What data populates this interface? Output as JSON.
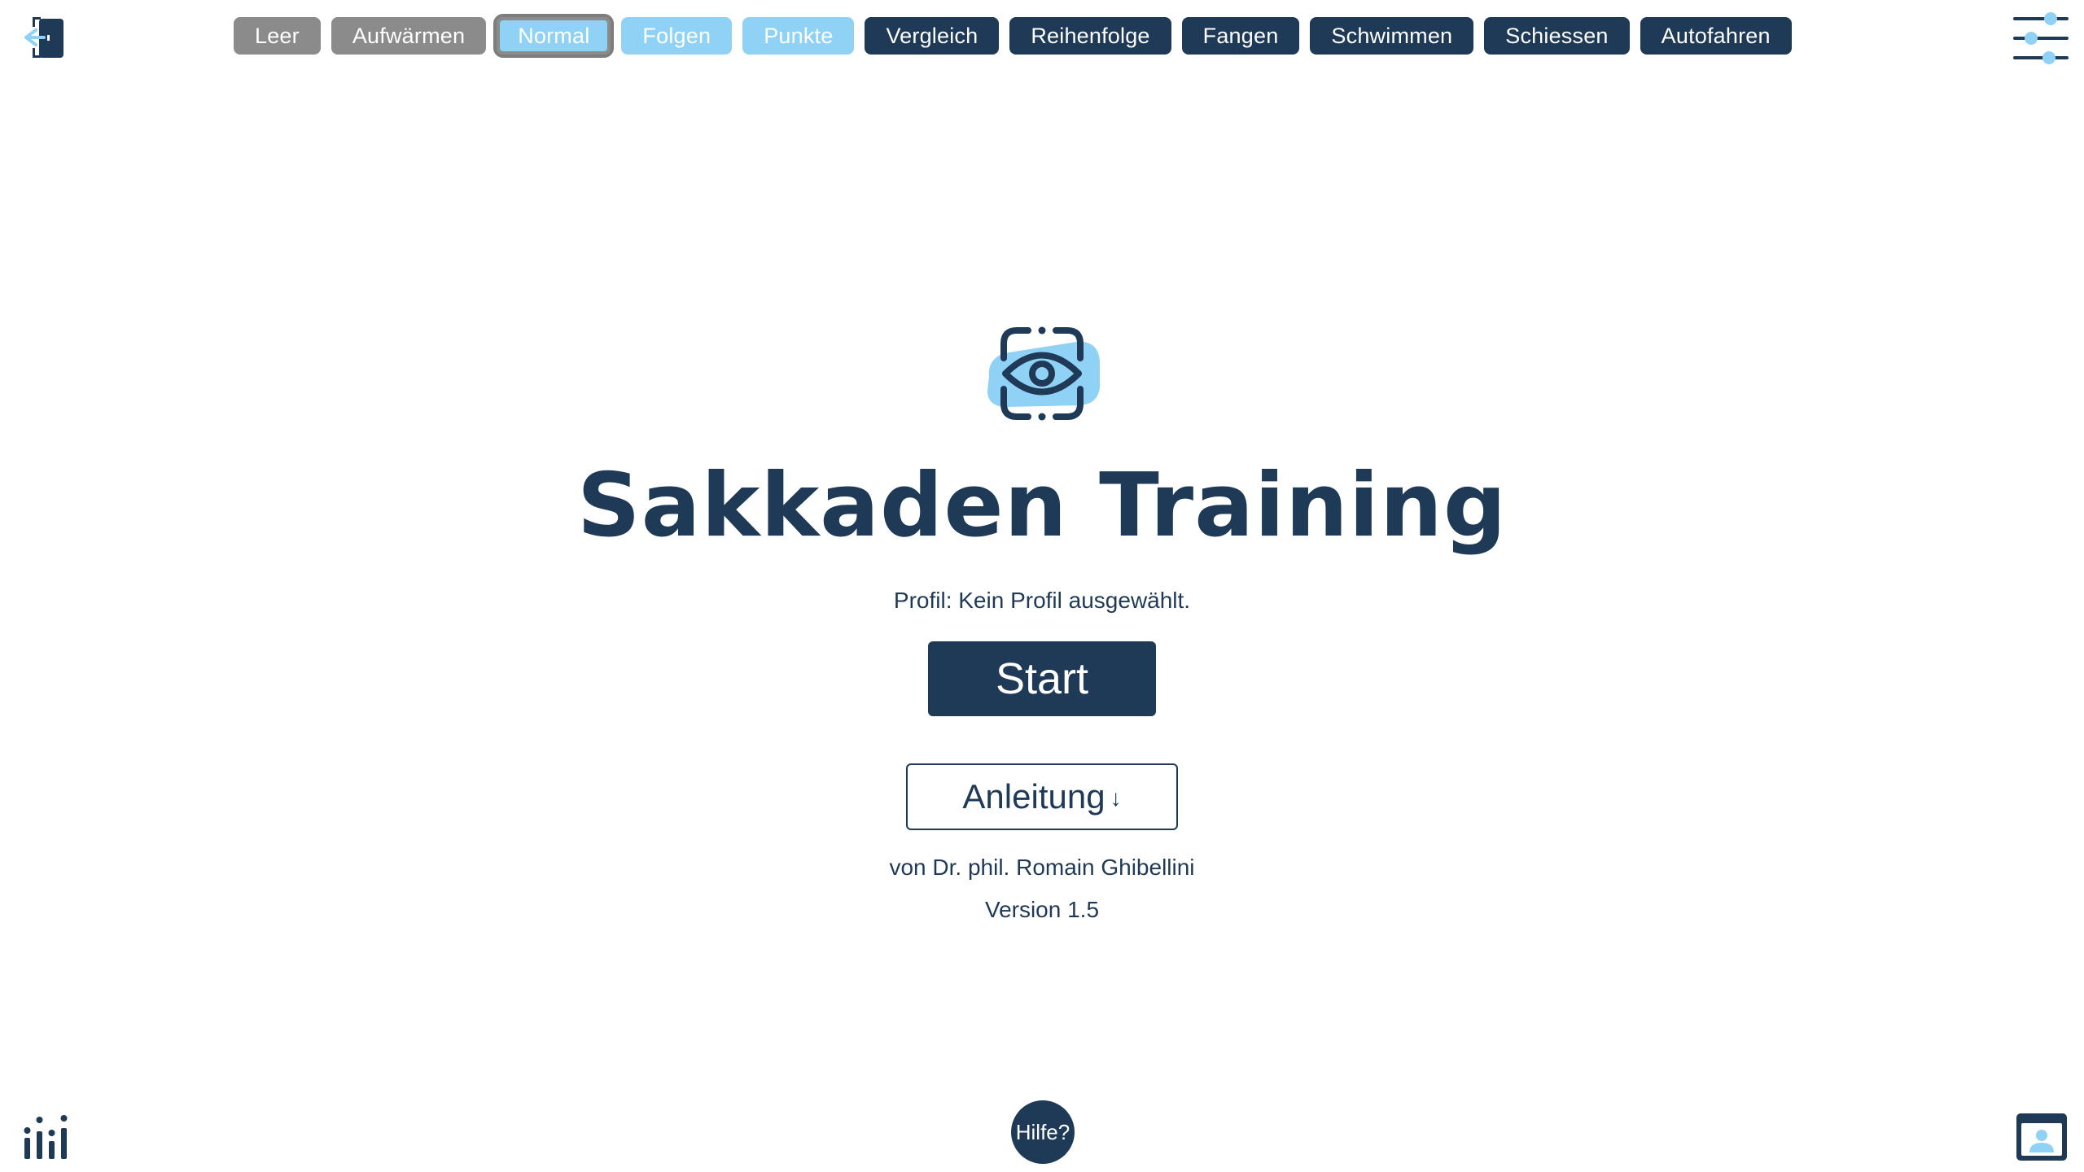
{
  "tabs": [
    {
      "label": "Leer",
      "style": "gray"
    },
    {
      "label": "Aufwärmen",
      "style": "gray"
    },
    {
      "label": "Normal",
      "style": "light",
      "selected": true
    },
    {
      "label": "Folgen",
      "style": "light"
    },
    {
      "label": "Punkte",
      "style": "light"
    },
    {
      "label": "Vergleich",
      "style": "dark"
    },
    {
      "label": "Reihenfolge",
      "style": "dark"
    },
    {
      "label": "Fangen",
      "style": "dark"
    },
    {
      "label": "Schwimmen",
      "style": "dark"
    },
    {
      "label": "Schiessen",
      "style": "dark"
    },
    {
      "label": "Autofahren",
      "style": "dark"
    }
  ],
  "main": {
    "title": "Sakkaden Training",
    "profile_text": "Profil: Kein Profil ausgewählt.",
    "start_label": "Start",
    "guide_label": "Anleitung",
    "guide_arrow": "↓",
    "author": "von Dr. phil. Romain Ghibellini",
    "version": "Version 1.5"
  },
  "help_label": "Hilfe?",
  "icons": {
    "exit": "exit-door-icon",
    "settings": "sliders-icon",
    "stats": "statistics-icon",
    "profile": "profile-card-icon",
    "logo": "eye-scan-icon"
  },
  "colors": {
    "primary": "#1f3a57",
    "accent": "#8fd2f5",
    "gray": "#8b8b8b"
  }
}
